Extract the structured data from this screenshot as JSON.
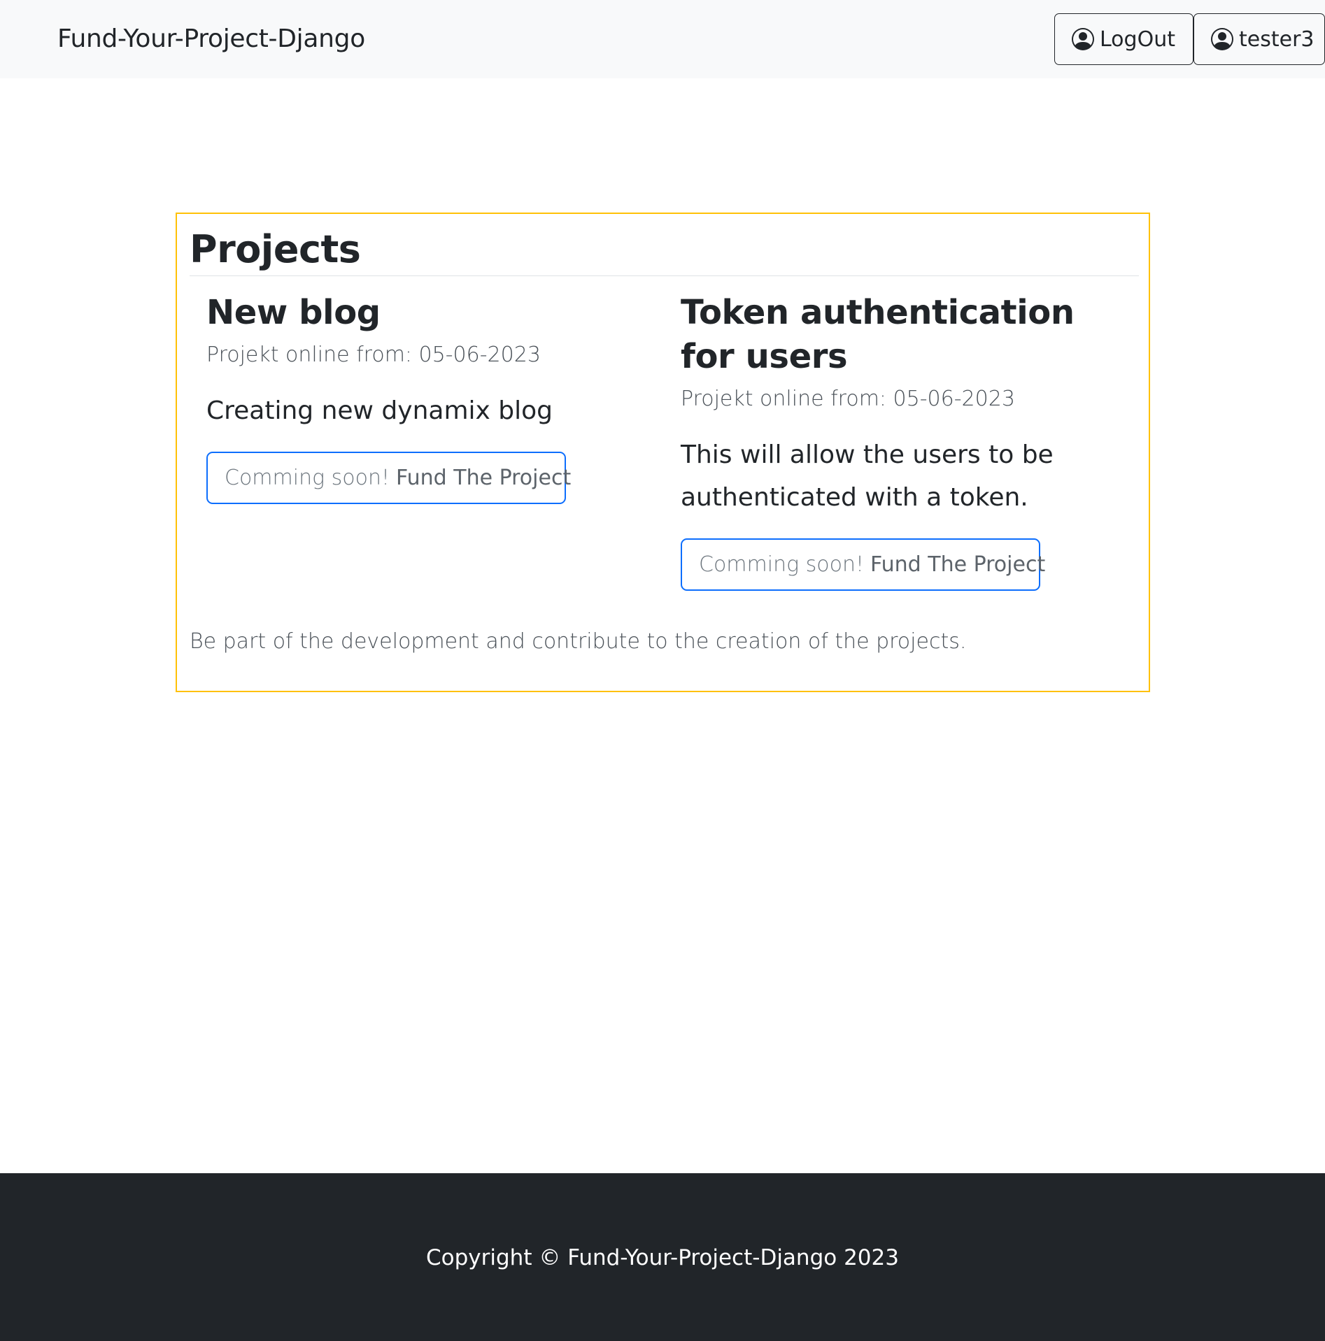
{
  "navbar": {
    "brand": "Fund-Your-Project-Django",
    "logout_label": "LogOut",
    "user_label": "tester3",
    "user_icon": "person-circle-icon"
  },
  "projects": {
    "heading": "Projects",
    "items": [
      {
        "name": "New blog",
        "online_from": "Projekt online from: 05-06-2023",
        "description": "Creating new dynamix blog",
        "button_prefix": "Comming soon!",
        "button_label": "Fund The Project"
      },
      {
        "name": "Token authentication for users",
        "online_from": "Projekt online from: 05-06-2023",
        "description": "This will allow the users to be authenticated with a token.",
        "button_prefix": "Comming soon!",
        "button_label": "Fund The Project"
      }
    ],
    "footer_text": "Be part of the development and contribute to the creation of the projects."
  },
  "footer": {
    "copyright": "Copyright © Fund-Your-Project-Django 2023"
  },
  "colors": {
    "navbar_bg": "#f8f9fa",
    "card_border": "#ffc107",
    "button_border": "#0d6efd",
    "footer_bg": "#212529"
  }
}
